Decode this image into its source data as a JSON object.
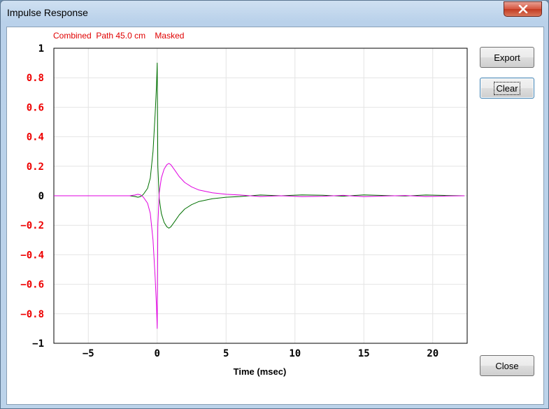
{
  "window": {
    "title": "Impulse Response"
  },
  "status": {
    "line": "Combined  Path 45.0 cm    Masked"
  },
  "buttons": {
    "export": "Export",
    "clear": "Clear",
    "close": "Close"
  },
  "colors": {
    "series_1": "#007000",
    "series_2": "#e000e0",
    "tick_highlight": "#ee0000",
    "status_text": "#e00000"
  },
  "icons": {
    "close": "close-icon"
  },
  "chart_data": {
    "type": "line",
    "title": "",
    "xlabel": "Time (msec)",
    "ylabel": "",
    "xlim": [
      -7.5,
      22.5
    ],
    "ylim": [
      -1,
      1
    ],
    "grid": true,
    "x_ticks": [
      -5,
      0,
      5,
      10,
      15,
      20
    ],
    "x_tick_labels": [
      "−5",
      "0",
      "5",
      "10",
      "15",
      "20"
    ],
    "y_ticks": [
      1,
      0.8,
      0.6,
      0.4,
      0.2,
      0,
      -0.2,
      -0.4,
      -0.6,
      -0.8,
      -1
    ],
    "y_tick_labels": [
      "1",
      "0.8",
      "0.6",
      "0.4",
      "0.2",
      "0",
      "−0.2",
      "−0.4",
      "−0.6",
      "−0.8",
      "−1"
    ],
    "series": [
      {
        "color": "#007000",
        "x": [
          -7.5,
          -2.0,
          -1.6,
          -1.4,
          -1.2,
          -1.0,
          -0.7,
          -0.5,
          -0.3,
          -0.15,
          -0.05,
          0.0,
          0.05,
          0.15,
          0.3,
          0.5,
          0.7,
          0.85,
          1.0,
          1.3,
          1.6,
          2.0,
          2.5,
          3.0,
          4.0,
          5.0,
          6.0,
          7.5,
          9.0,
          10.5,
          12.0,
          13.5,
          15.0,
          16.5,
          18.0,
          19.5,
          21.0,
          22.3
        ],
        "y": [
          0.0,
          0.0,
          -0.005,
          -0.01,
          -0.005,
          0.01,
          0.05,
          0.12,
          0.3,
          0.55,
          0.75,
          0.9,
          0.2,
          -0.02,
          -0.12,
          -0.18,
          -0.21,
          -0.22,
          -0.21,
          -0.17,
          -0.13,
          -0.09,
          -0.06,
          -0.04,
          -0.02,
          -0.01,
          -0.005,
          0.005,
          0.0,
          0.006,
          0.004,
          -0.003,
          0.006,
          0.002,
          -0.002,
          0.005,
          0.002,
          0.0
        ]
      },
      {
        "color": "#e000e0",
        "x": [
          -7.5,
          -2.0,
          -1.6,
          -1.4,
          -1.2,
          -1.0,
          -0.7,
          -0.5,
          -0.3,
          -0.15,
          -0.05,
          0.0,
          0.05,
          0.15,
          0.3,
          0.5,
          0.7,
          0.85,
          1.0,
          1.3,
          1.6,
          2.0,
          2.5,
          3.0,
          4.0,
          5.0,
          6.0,
          7.5,
          9.0,
          10.5,
          12.0,
          13.5,
          15.0,
          16.5,
          18.0,
          19.5,
          21.0,
          22.3
        ],
        "y": [
          0.0,
          0.0,
          0.005,
          0.01,
          0.005,
          -0.01,
          -0.05,
          -0.12,
          -0.3,
          -0.55,
          -0.75,
          -0.9,
          -0.2,
          0.02,
          0.12,
          0.18,
          0.21,
          0.22,
          0.21,
          0.17,
          0.13,
          0.09,
          0.06,
          0.04,
          0.02,
          0.01,
          0.005,
          -0.005,
          0.0,
          -0.006,
          -0.004,
          0.003,
          -0.006,
          -0.002,
          0.002,
          -0.005,
          -0.002,
          0.0
        ]
      }
    ]
  }
}
